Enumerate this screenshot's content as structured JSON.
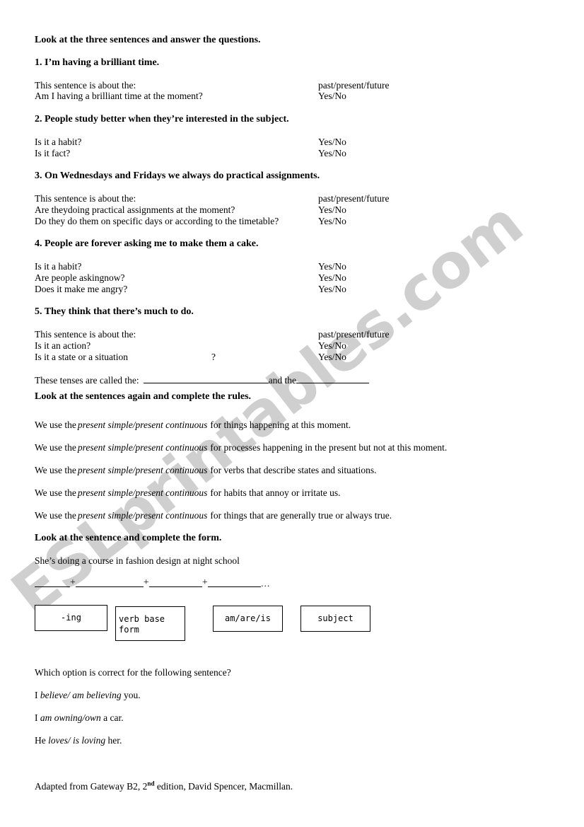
{
  "document": {
    "watermark": "ESLprintables.com",
    "watermark_color": "#cfcfcf"
  },
  "section1": {
    "heading": "Look at the three sentences and answer the questions.",
    "items": [
      {
        "number": "1.",
        "sentence": "I’m having a brilliant time.",
        "questions": [
          {
            "prompt": "This sentence is about the:",
            "answer": "past/present/future"
          },
          {
            "prompt": "Am I having a brilliant time at the moment?",
            "answer": "Yes/No"
          }
        ]
      },
      {
        "number": "2.",
        "sentence": "People study better when they’re interested in the subject.",
        "questions": [
          {
            "prompt": "Is it a habit?",
            "answer": "Yes/No"
          },
          {
            "prompt": "Is it fact?",
            "answer": "Yes/No"
          }
        ]
      },
      {
        "number": "3.",
        "sentence": "On Wednesdays and Fridays we always do practical assignments.",
        "questions": [
          {
            "prompt": "This sentence is about the:",
            "answer": "past/present/future"
          },
          {
            "prompt": "Are theydoing practical assignments at the moment?",
            "answer": "Yes/No"
          },
          {
            "prompt": "Do they do them on specific days or according to the timetable?",
            "answer": "Yes/No"
          }
        ]
      },
      {
        "number": "4.",
        "sentence": "People are forever asking me to make them a cake.",
        "questions": [
          {
            "prompt": "Is it a habit?",
            "answer": "Yes/No"
          },
          {
            "prompt": "Are people askingnow?",
            "answer": "Yes/No"
          },
          {
            "prompt": "Does it make me angry?",
            "answer": "Yes/No"
          }
        ]
      },
      {
        "number": "5.",
        "sentence": "They think that there’s much to do.",
        "questions": [
          {
            "prompt": "This sentence is about the:",
            "answer": "past/present/future"
          },
          {
            "prompt": "Is it an action?",
            "answer": "Yes/No"
          },
          {
            "prompt": "Is it a state or a situation",
            "prompt_tail": "?",
            "answer": "Yes/No"
          }
        ]
      }
    ],
    "tenses_line": {
      "lead": "These tenses are called the:",
      "middle": "and the"
    }
  },
  "section2": {
    "heading": "Look at the sentences again and complete the rules.",
    "rules": [
      {
        "lead": "We use the",
        "choice": "present simple/present continuous",
        "tail": "for things happening at this moment."
      },
      {
        "lead": "We use the",
        "choice": "present simple/present continuous",
        "tail": "for processes happening in the present but not at this moment."
      },
      {
        "lead": "We use the",
        "choice": "present simple/present continuous",
        "tail": "for verbs that describe states and situations."
      },
      {
        "lead": "We use the",
        "choice": "present simple/present continuous",
        "tail": "for habits that annoy or irritate us."
      },
      {
        "lead": "We use the",
        "choice": "present simple/present continuous",
        "tail": "for things that are generally true or always true."
      }
    ]
  },
  "section3": {
    "heading": "Look at the sentence and complete the form.",
    "example": "She’s doing a course in fashion design at night school",
    "plus": "+",
    "ellipsis": "…",
    "boxes": [
      {
        "label": "-ing"
      },
      {
        "label": "verb base\nform",
        "line1": "verb base",
        "line2": "form"
      },
      {
        "label": "am/are/is"
      },
      {
        "label": "subject"
      }
    ]
  },
  "section4": {
    "question": "Which option is correct for the following sentence?",
    "sentences": [
      {
        "pre": "I",
        "choice": "believe/ am believing",
        "post": "you."
      },
      {
        "pre": "I",
        "choice": "am owning/own",
        "post": "a car."
      },
      {
        "pre": "He",
        "choice": "loves/ is loving",
        "post": "her."
      }
    ]
  },
  "footer": {
    "pre": "Adapted from Gateway B2, 2",
    "sup": "nd",
    "post": " edition, David Spencer, Macmillan."
  }
}
